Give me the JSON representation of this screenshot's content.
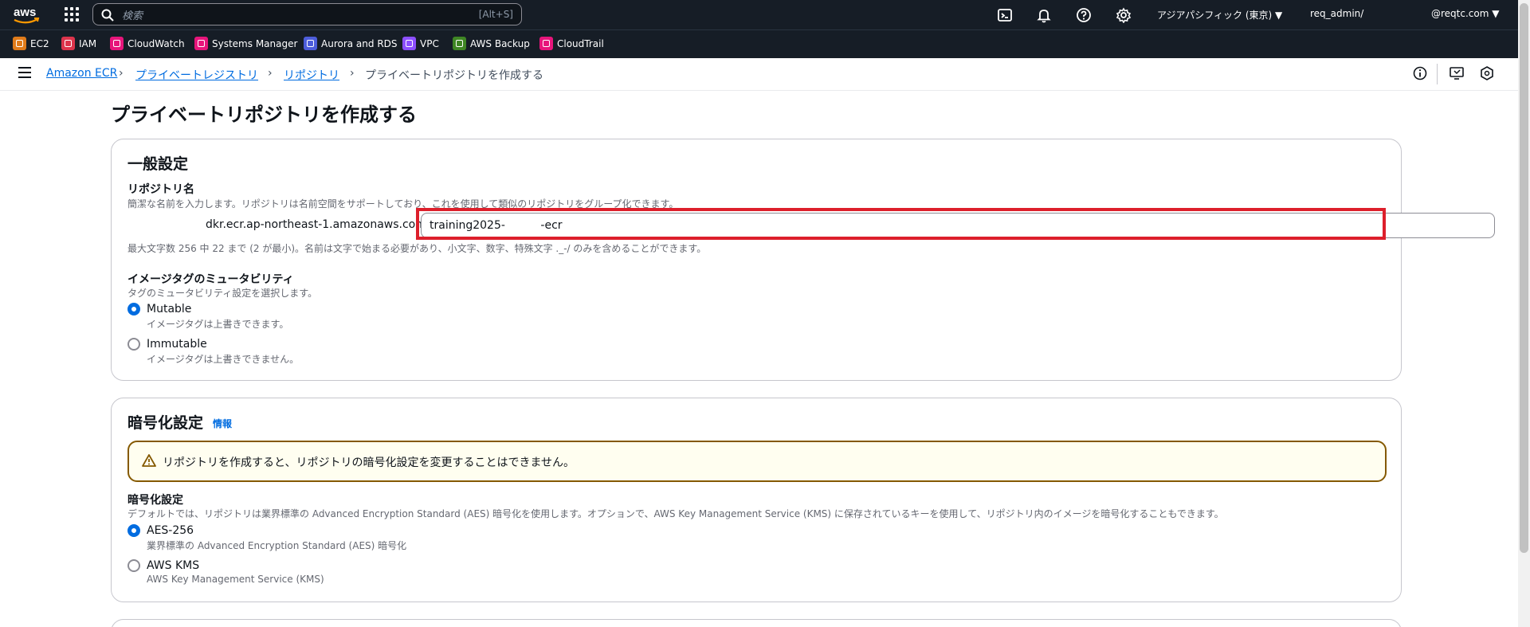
{
  "topnav": {
    "logo": "aws",
    "search_placeholder": "検索",
    "search_shortcut": "[Alt+S]",
    "region": "アジアパシフィック (東京) ▼",
    "account_left": "req_admin/",
    "account_right": "@reqtc.com ▼",
    "icons": [
      "cloudshell-icon",
      "bell-icon",
      "help-icon",
      "gear-icon"
    ]
  },
  "favorites": [
    {
      "label": "EC2",
      "color": "#e07b1a"
    },
    {
      "label": "IAM",
      "color": "#dd344c"
    },
    {
      "label": "CloudWatch",
      "color": "#e7157b"
    },
    {
      "label": "Systems Manager",
      "color": "#e7157b"
    },
    {
      "label": "Aurora and RDS",
      "color": "#4d5ddb"
    },
    {
      "label": "VPC",
      "color": "#8c4fff"
    },
    {
      "label": "AWS Backup",
      "color": "#3f8624"
    },
    {
      "label": "CloudTrail",
      "color": "#e7157b"
    }
  ],
  "breadcrumb": {
    "items": [
      "Amazon ECR",
      "プライベートレジストリ",
      "リポジトリ"
    ],
    "current": "プライベートリポジトリを作成する",
    "separator": "›"
  },
  "page": {
    "title": "プライベートリポジトリを作成する"
  },
  "general": {
    "title": "一般設定",
    "repo_name_label": "リポジトリ名",
    "repo_name_desc": "簡潔な名前を入力します。リポジトリは名前空間をサポートしており、これを使用して類似のリポジトリをグループ化できます。",
    "uri_prefix": "dkr.ecr.ap-northeast-1.amazonaws.com/",
    "repo_name_value": "training2025-          -ecr",
    "constraint": "最大文字数 256 中 22 まで (2 が最小)。名前は文字で始まる必要があり、小文字、数字、特殊文字 ._-/ のみを含めることができます。",
    "mutability_label": "イメージタグのミュータビリティ",
    "mutability_desc": "タグのミュータビリティ設定を選択します。",
    "options": [
      {
        "label": "Mutable",
        "desc": "イメージタグは上書きできます。",
        "selected": true
      },
      {
        "label": "Immutable",
        "desc": "イメージタグは上書きできません。",
        "selected": false
      }
    ]
  },
  "encryption": {
    "title": "暗号化設定",
    "info": "情報",
    "warning": "リポジトリを作成すると、リポジトリの暗号化設定を変更することはできません。",
    "setting_label": "暗号化設定",
    "setting_desc": "デフォルトでは、リポジトリは業界標準の Advanced Encryption Standard (AES) 暗号化を使用します。オプションで、AWS Key Management Service (KMS) に保存されているキーを使用して、リポジトリ内のイメージを暗号化することもできます。",
    "options": [
      {
        "label": "AES-256",
        "desc": "業界標準の Advanced Encryption Standard (AES) 暗号化",
        "selected": true
      },
      {
        "label": "AWS KMS",
        "desc": "AWS Key Management Service (KMS)",
        "selected": false
      }
    ]
  }
}
